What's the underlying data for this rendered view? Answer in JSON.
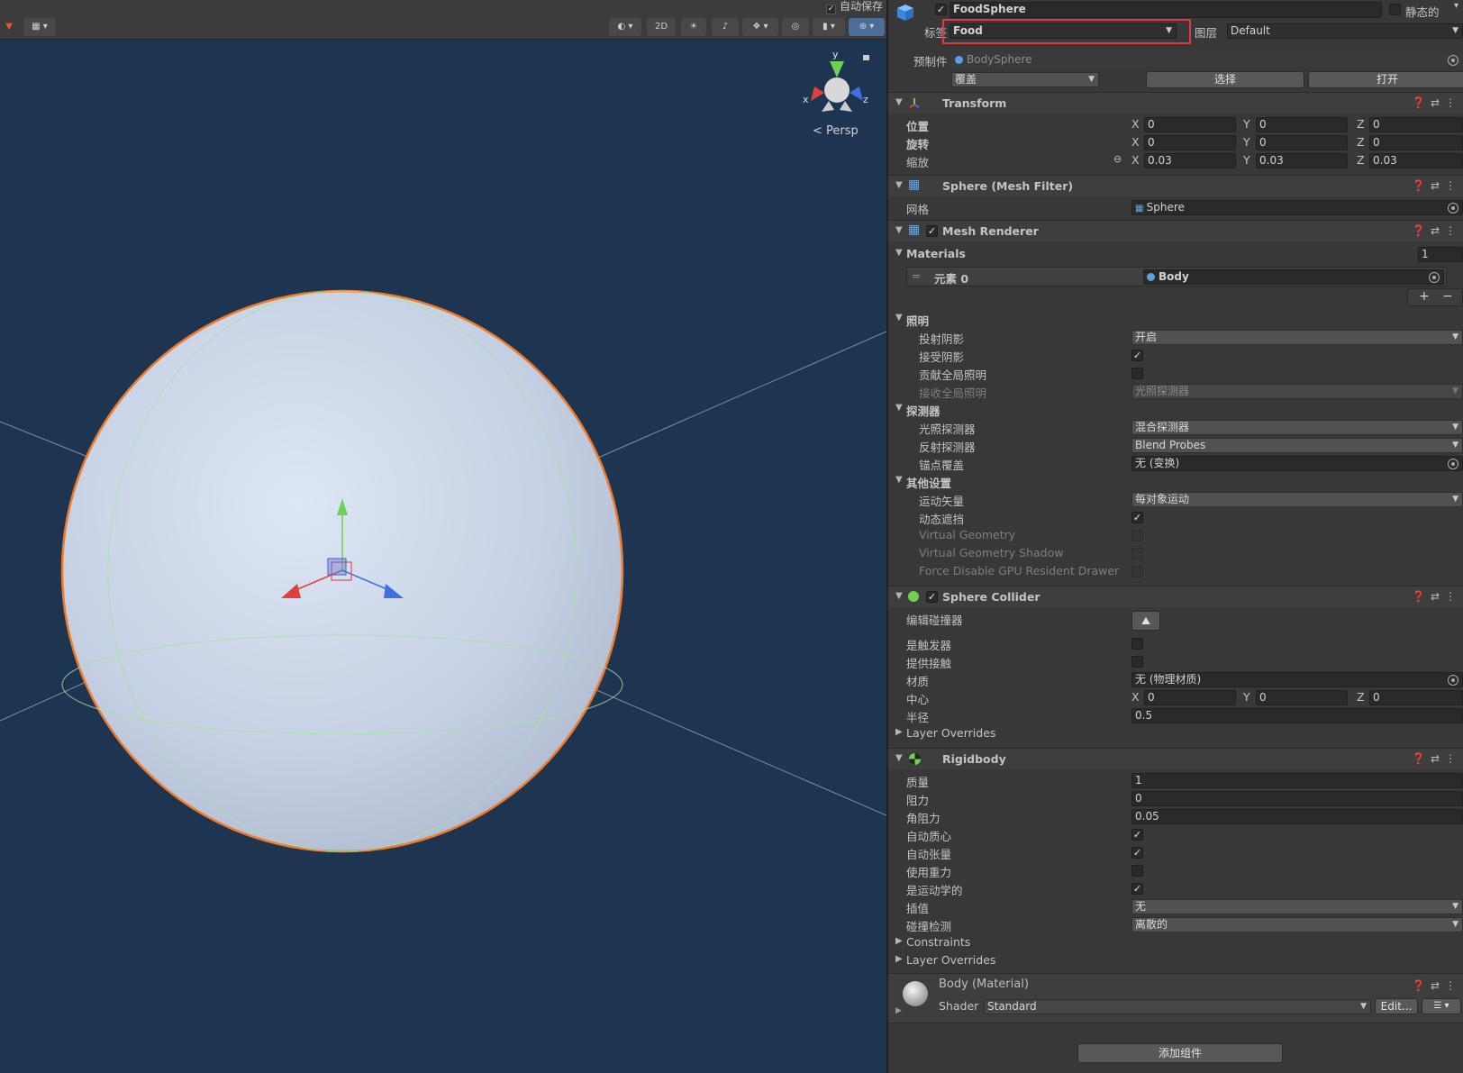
{
  "scene": {
    "autosave_label": "自动保存",
    "btn_2d": "2D",
    "persp_label": "< Persp",
    "gizmo": {
      "x": "x",
      "y": "y",
      "z": "z"
    }
  },
  "header": {
    "object_name": "FoodSphere",
    "static_label": "静态的",
    "tag_label": "标签",
    "tag_value": "Food",
    "layer_label": "图层",
    "layer_value": "Default",
    "prefab_label": "预制件",
    "prefab_value": "BodySphere",
    "overrides_label": "覆盖",
    "select_label": "选择",
    "open_label": "打开"
  },
  "transform": {
    "title": "Transform",
    "position_label": "位置",
    "rotation_label": "旋转",
    "scale_label": "缩放",
    "position": {
      "x": "0",
      "y": "0",
      "z": "0"
    },
    "rotation": {
      "x": "0",
      "y": "0",
      "z": "0"
    },
    "scale": {
      "x": "0.03",
      "y": "0.03",
      "z": "0.03"
    }
  },
  "mesh_filter": {
    "title": "Sphere (Mesh Filter)",
    "mesh_label": "网格",
    "mesh_value": "Sphere"
  },
  "mesh_renderer": {
    "title": "Mesh Renderer",
    "materials_label": "Materials",
    "materials_count": "1",
    "element_label": "元素 0",
    "element_value": "Body",
    "lighting_label": "照明",
    "cast_shadows_label": "投射阴影",
    "cast_shadows_value": "开启",
    "receive_shadows_label": "接受阴影",
    "contribute_gi_label": "贡献全局照明",
    "receive_gi_label": "接收全局照明",
    "receive_gi_value": "光照探测器",
    "probes_label": "探测器",
    "light_probes_label": "光照探测器",
    "light_probes_value": "混合探测器",
    "reflection_probes_label": "反射探测器",
    "reflection_probes_value": "Blend Probes",
    "anchor_override_label": "锚点覆盖",
    "anchor_override_value": "无 (变换)",
    "other_label": "其他设置",
    "motion_vectors_label": "运动矢量",
    "motion_vectors_value": "每对象运动",
    "dynamic_occlusion_label": "动态遮挡",
    "virtual_geometry_label": "Virtual Geometry",
    "virtual_geometry_shadow_label": "Virtual Geometry Shadow",
    "force_disable_label": "Force Disable GPU Resident Drawer"
  },
  "sphere_collider": {
    "title": "Sphere Collider",
    "edit_collider_label": "编辑碰撞器",
    "is_trigger_label": "是触发器",
    "provides_contacts_label": "提供接触",
    "material_label": "材质",
    "material_value": "无 (物理材质)",
    "center_label": "中心",
    "center": {
      "x": "0",
      "y": "0",
      "z": "0"
    },
    "radius_label": "半径",
    "radius_value": "0.5",
    "layer_overrides_label": "Layer Overrides"
  },
  "rigidbody": {
    "title": "Rigidbody",
    "mass_label": "质量",
    "mass_value": "1",
    "drag_label": "阻力",
    "drag_value": "0",
    "angular_drag_label": "角阻力",
    "angular_drag_value": "0.05",
    "auto_com_label": "自动质心",
    "auto_tensor_label": "自动张量",
    "use_gravity_label": "使用重力",
    "is_kinematic_label": "是运动学的",
    "interpolate_label": "插值",
    "interpolate_value": "无",
    "collision_detection_label": "碰撞检测",
    "collision_detection_value": "离散的",
    "constraints_label": "Constraints",
    "layer_overrides_label": "Layer Overrides"
  },
  "material": {
    "title": "Body (Material)",
    "shader_label": "Shader",
    "shader_value": "Standard",
    "edit_label": "Edit..."
  },
  "add_component_label": "添加组件",
  "colors": {
    "highlight_box": "#e0383c",
    "scene_bg": "#1e3552",
    "selection_outline": "#f07a26"
  }
}
